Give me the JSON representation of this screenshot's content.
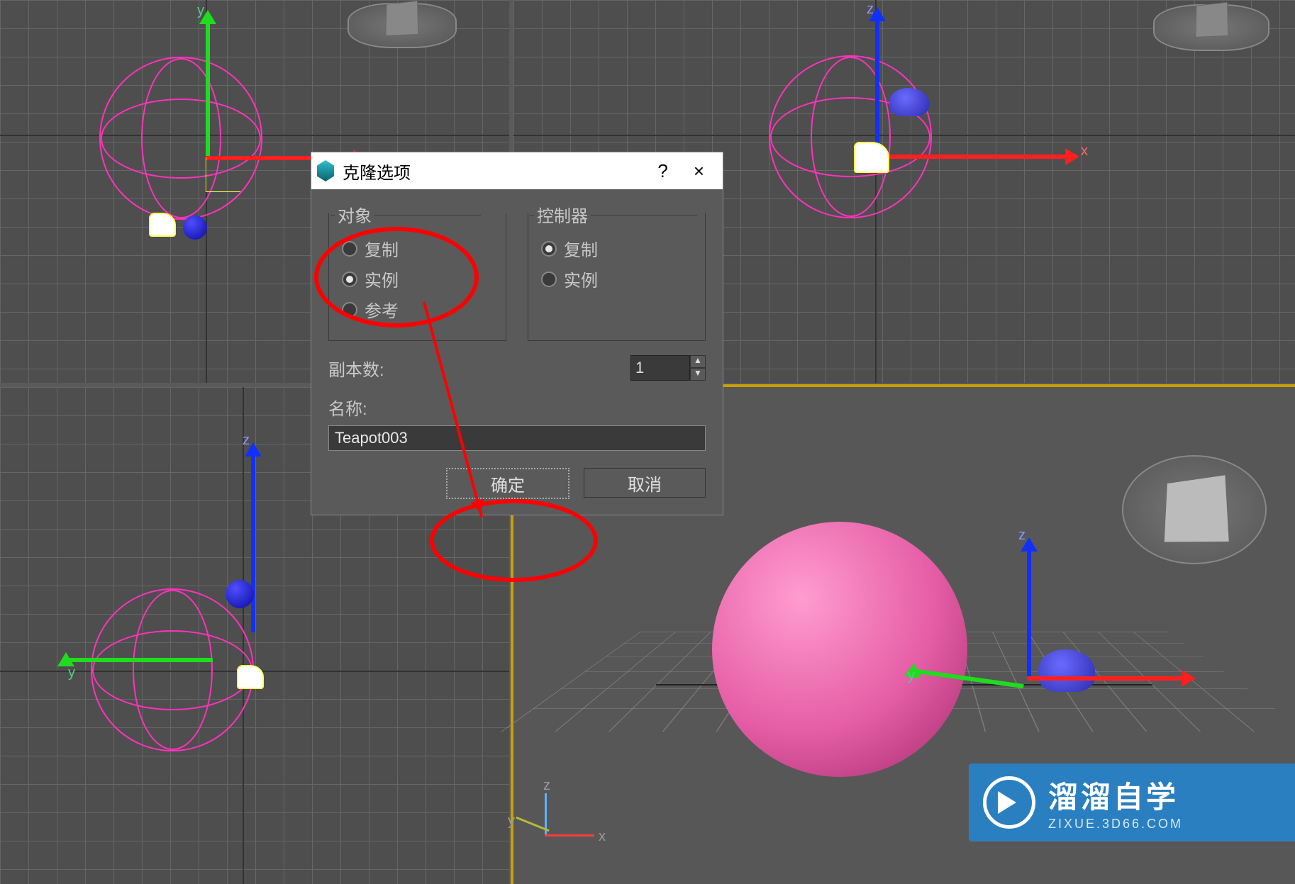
{
  "dialog": {
    "title": "克隆选项",
    "help_symbol": "?",
    "close_symbol": "×",
    "group_object_title": "对象",
    "group_controller_title": "控制器",
    "opt_copy": "复制",
    "opt_instance": "实例",
    "opt_reference": "参考",
    "copies_label": "副本数:",
    "copies_value": "1",
    "name_label": "名称:",
    "name_value": "Teapot003",
    "btn_ok": "确定",
    "btn_cancel": "取消"
  },
  "axes": {
    "x": "x",
    "y": "y",
    "z": "z"
  },
  "watermark": {
    "title": "溜溜自学",
    "sub": "ZIXUE.3D66.COM"
  }
}
